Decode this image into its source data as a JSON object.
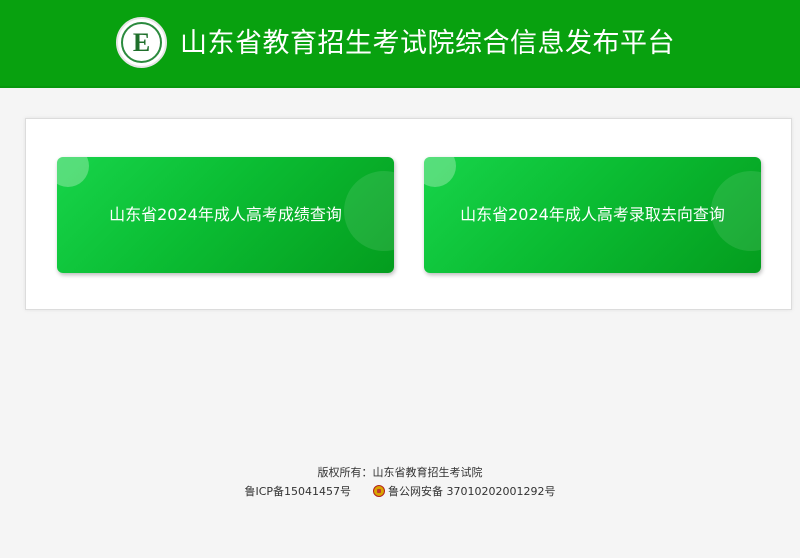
{
  "header": {
    "title": "山东省教育招生考试院综合信息发布平台",
    "logo_icon": "exam-institute-emblem",
    "logo_letter": "E",
    "color": "#08a10f"
  },
  "cards": [
    {
      "label": "山东省2024年成人高考成绩查询"
    },
    {
      "label": "山东省2024年成人高考录取去向查询"
    }
  ],
  "footer": {
    "copyright": "版权所有：山东省教育招生考试院",
    "icp": "鲁ICP备15041457号",
    "police_record": "鲁公网安备 37010202001292号",
    "police_icon": "police-badge-icon"
  }
}
